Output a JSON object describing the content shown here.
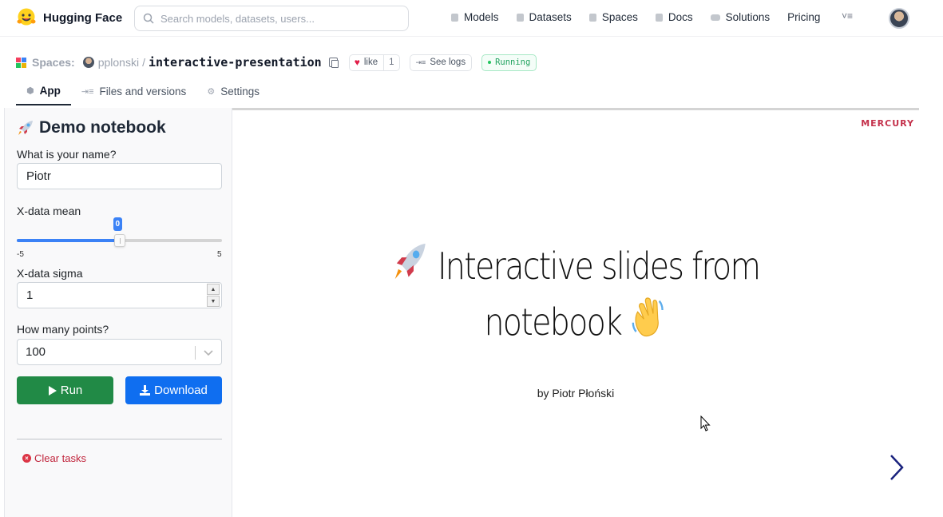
{
  "navbar": {
    "brand": "Hugging Face",
    "search_placeholder": "Search models, datasets, users...",
    "links": [
      "Models",
      "Datasets",
      "Spaces",
      "Docs",
      "Solutions",
      "Pricing"
    ]
  },
  "header": {
    "section": "Spaces:",
    "owner": "pplonski",
    "separator": "/",
    "repo": "interactive-presentation",
    "like_label": "like",
    "like_count": "1",
    "logs_label": "See logs",
    "status": "Running"
  },
  "tabs": [
    {
      "label": "App",
      "icon": "cube-icon"
    },
    {
      "label": "Files and versions",
      "icon": "files-icon"
    },
    {
      "label": "Settings",
      "icon": "gear-icon"
    }
  ],
  "sidebar": {
    "title": "Demo notebook",
    "name_label": "What is your name?",
    "name_value": "Piotr",
    "mean_label": "X-data mean",
    "mean_value": "0",
    "mean_min": "-5",
    "mean_max": "5",
    "mean_level": 0.5,
    "sigma_label": "X-data sigma",
    "sigma_value": "1",
    "points_label": "How many points?",
    "points_value": "100",
    "run_label": "Run",
    "download_label": "Download",
    "clear_label": "Clear tasks"
  },
  "slide": {
    "brand": "MERCURY",
    "title_line1": "Interactive slides from",
    "title_line2": "notebook",
    "byline": "by Piotr Płoński"
  },
  "colors": {
    "run": "#218a46",
    "download": "#0f6ef0",
    "slider": "#3b82f6",
    "status": "#22a360",
    "next_arrow": "#1a237e"
  }
}
